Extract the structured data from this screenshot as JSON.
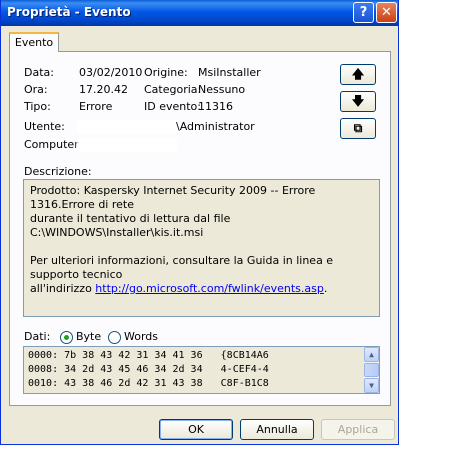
{
  "window": {
    "title": "Proprietà - Evento",
    "help_glyph": "?",
    "close_glyph": "✕"
  },
  "tabs": [
    {
      "label": "Evento"
    }
  ],
  "fields": {
    "date_label": "Data:",
    "date_value": "03/02/2010",
    "time_label": "Ora:",
    "time_value": "17.20.42",
    "type_label": "Tipo:",
    "type_value": "Errore",
    "user_label": "Utente:",
    "user_value_visible": "\\Administrator",
    "computer_label": "Computer:",
    "source_label": "Origine:",
    "source_value": "MsiInstaller",
    "category_label": "Categoria:",
    "category_value": "Nessuno",
    "event_id_label": "ID evento:",
    "event_id_value": "11316"
  },
  "nav": {
    "up_glyph": "🡅",
    "down_glyph": "🡇",
    "copy_glyph": "⧉"
  },
  "description": {
    "label": "Descrizione:",
    "line1": "Prodotto: Kaspersky Internet Security 2009 -- Errore 1316.Errore di rete",
    "line2": "durante il tentativo di lettura dal file C:\\WINDOWS\\Installer\\kis.it.msi",
    "line3": "Per ulteriori informazioni, consultare la Guida in linea e supporto tecnico",
    "line4_prefix": "all'indirizzo ",
    "link": "http://go.microsoft.com/fwlink/events.asp",
    "line4_suffix": "."
  },
  "data_section": {
    "label": "Dati:",
    "byte_label": "Byte",
    "words_label": "Words",
    "selected": "Byte",
    "rows": [
      "0000: 7b 38 43 42 31 34 41 36   {8CB14A6",
      "0008: 34 2d 43 45 46 34 2d 34   4-CEF4-4",
      "0010: 43 38 46 2d 42 31 43 38   C8F-B1C8"
    ]
  },
  "buttons": {
    "ok": "OK",
    "cancel": "Annulla",
    "apply": "Applica"
  },
  "colors": {
    "titlebar": "#0058e6",
    "face": "#ece9d8",
    "link": "#0000ee",
    "radio_selected": "#21a121"
  }
}
